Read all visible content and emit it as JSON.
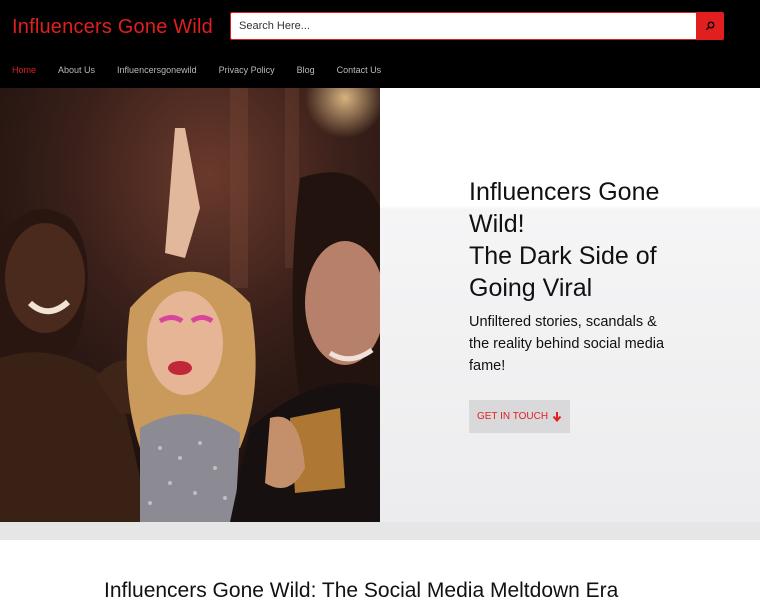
{
  "header": {
    "brand": "Influencers Gone Wild",
    "search": {
      "placeholder": "Search Here...",
      "button_icon": "search-icon"
    }
  },
  "nav": {
    "items": [
      {
        "label": "Home",
        "active": true
      },
      {
        "label": "About Us"
      },
      {
        "label": "Influencersgonewild"
      },
      {
        "label": "Privacy Policy"
      },
      {
        "label": "Blog"
      },
      {
        "label": "Contact Us"
      }
    ]
  },
  "hero": {
    "image": "party-crowd-photo",
    "title_lines": [
      "Influencers Gone",
      "Wild!",
      "The Dark Side of",
      "Going Viral"
    ],
    "subtitle_lines": [
      "Unfiltered stories, scandals &",
      "the reality behind social media",
      "fame!"
    ],
    "cta_label": "GET IN TOUCH",
    "cta_icon": "arrow-down-icon"
  },
  "article": {
    "title": "Influencers Gone Wild: The Social Media Meltdown Era"
  },
  "colors": {
    "accent": "#e11f1f",
    "header_bg": "#000000",
    "nav_text": "#b9b9b9",
    "cta_bg": "#d9d9dc"
  }
}
